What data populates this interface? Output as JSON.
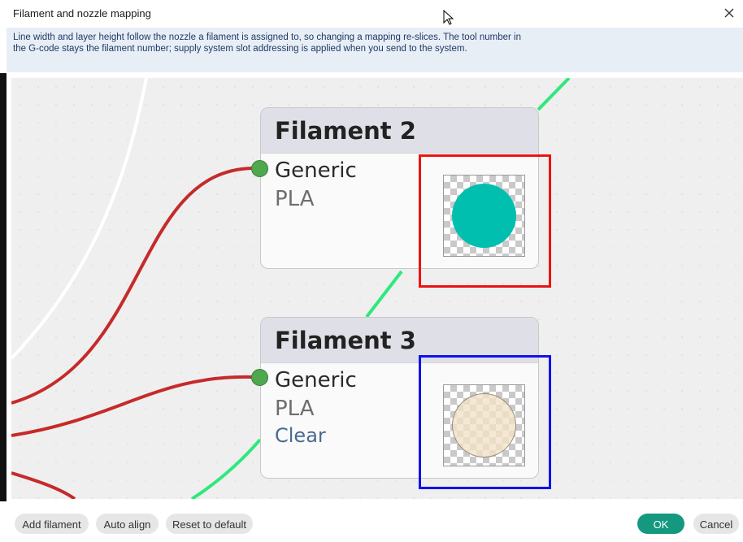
{
  "window": {
    "title": "Filament and nozzle mapping"
  },
  "info": {
    "text": "Line width and layer height follow the nozzle a filament is assigned to, so changing a mapping re-slices. The tool number in the G-code stays the filament number; supply system slot addressing is applied when you send to the system."
  },
  "nodes": [
    {
      "title": "Filament 2",
      "line1": "Generic",
      "line2": "PLA",
      "swatch_color": "#00bfae",
      "highlight_color": "#ee1111"
    },
    {
      "title": "Filament 3",
      "line1": "Generic",
      "line2": "PLA",
      "line3": "Clear",
      "swatch_color": "#f3e2c8",
      "highlight_color": "#1111ee"
    }
  ],
  "wire_colors": {
    "filament": "#c62a2a",
    "nozzle": "#2ee87c",
    "white": "#ffffff"
  },
  "buttons": {
    "add_filament": "Add filament",
    "auto_align": "Auto align",
    "reset": "Reset to default",
    "ok": "OK",
    "cancel": "Cancel"
  }
}
